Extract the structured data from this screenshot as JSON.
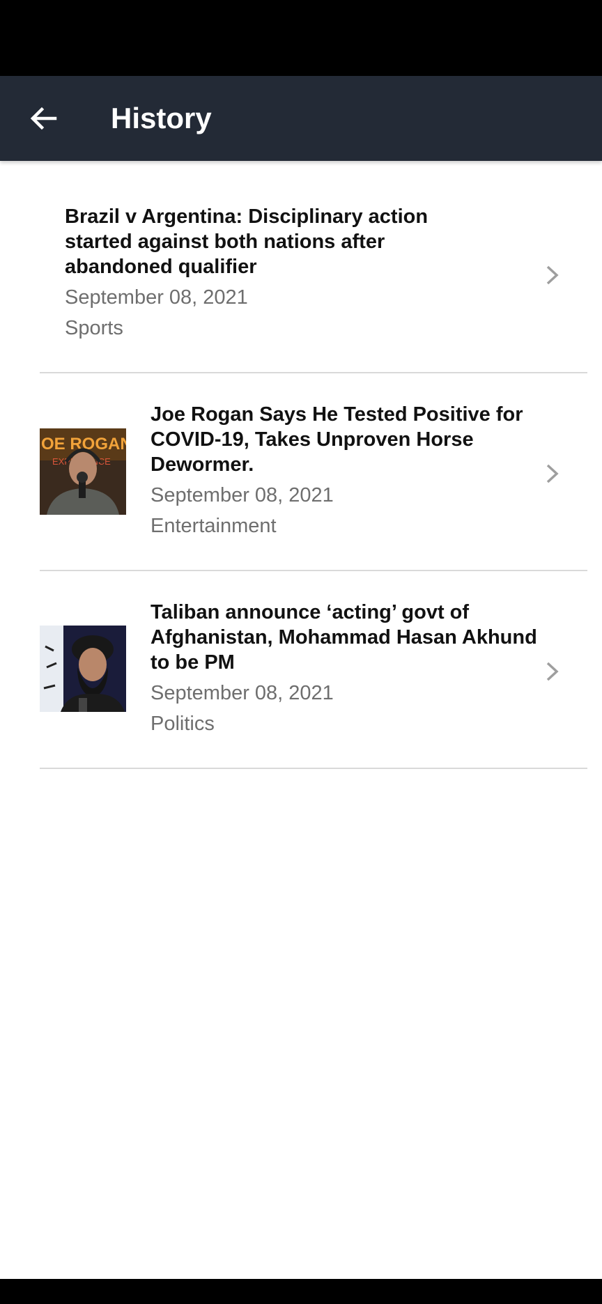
{
  "app_bar": {
    "title": "History",
    "back_icon": "arrow-left-icon"
  },
  "history": {
    "items": [
      {
        "headline": "Brazil v Argentina: Disciplinary action started against both nations after abandoned qualifier",
        "date": "September 08, 2021",
        "category": "Sports",
        "has_image": false
      },
      {
        "headline": "Joe Rogan Says He Tested Positive for COVID-19, Takes Unproven Horse Dewormer.",
        "date": "September 08, 2021",
        "category": "Entertainment",
        "has_image": true
      },
      {
        "headline": "Taliban announce ‘acting’ govt of Afghanistan, Mohammad Hasan Akhund to be PM",
        "date": "September 08, 2021",
        "category": "Politics",
        "has_image": true
      }
    ]
  },
  "colors": {
    "app_bar_bg": "#232a36",
    "title_text": "#ffffff",
    "meta_text": "#6e6e6e",
    "divider": "#d9d9d9",
    "chevron": "#9e9e9e"
  }
}
